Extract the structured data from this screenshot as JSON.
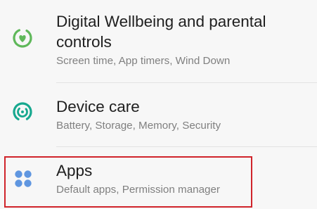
{
  "settings": {
    "items": [
      {
        "icon": "digital-wellbeing-icon",
        "title_line1": "Digital Wellbeing and parental",
        "title_line2": "controls",
        "subtitle": "Screen time, App timers, Wind Down"
      },
      {
        "icon": "device-care-icon",
        "title": "Device care",
        "subtitle": "Battery, Storage, Memory, Security"
      },
      {
        "icon": "apps-icon",
        "title": "Apps",
        "subtitle": "Default apps, Permission manager"
      }
    ]
  },
  "colors": {
    "background": "#f7f7f7",
    "wellbeing_icon": "#5fb85a",
    "device_care_icon": "#17a88f",
    "apps_icon": "#5f96e0",
    "highlight": "#d0242b"
  }
}
